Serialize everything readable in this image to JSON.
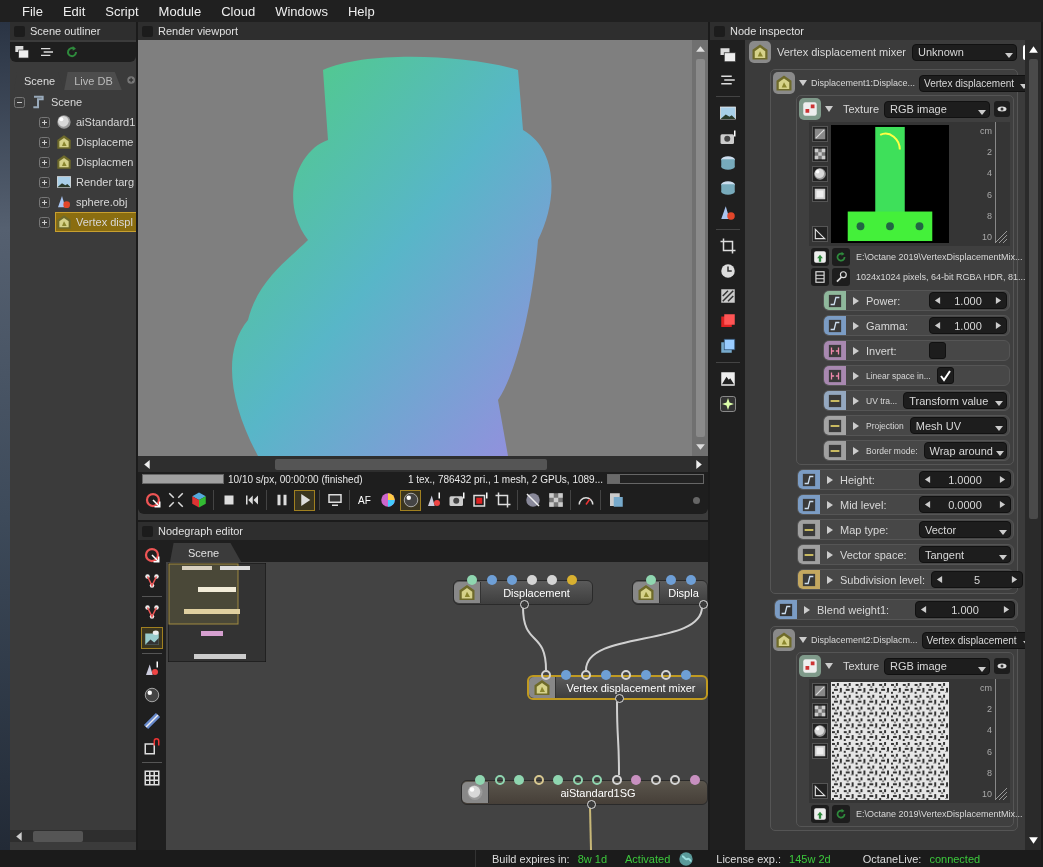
{
  "menu": [
    "File",
    "Edit",
    "Script",
    "Module",
    "Cloud",
    "Windows",
    "Help"
  ],
  "outliner": {
    "title": "Scene outliner",
    "tabs": [
      {
        "label": "Scene",
        "selected": true
      },
      {
        "label": "Live DB",
        "selected": false
      }
    ],
    "root": {
      "label": "Scene",
      "expanded": true,
      "children": [
        {
          "label": "aiStandard1",
          "kind": "material",
          "expanded": false,
          "selected": false
        },
        {
          "label": "Displaceme",
          "kind": "displacement",
          "expanded": false,
          "selected": false
        },
        {
          "label": "Displacmen",
          "kind": "displacement",
          "expanded": false,
          "selected": false
        },
        {
          "label": "Render targ",
          "kind": "render-target",
          "expanded": false,
          "selected": false
        },
        {
          "label": "sphere.obj",
          "kind": "mesh",
          "expanded": false,
          "selected": false
        },
        {
          "label": "Vertex displ",
          "kind": "displacement",
          "expanded": false,
          "selected": true
        }
      ]
    }
  },
  "viewport": {
    "title": "Render viewport",
    "progress": {
      "level": 1
    },
    "status": "10/10 s/px, 00:00:00 (finished)",
    "stats": "1 tex., 786432 pri., 1 mesh, 2 GPUs, 1089...",
    "memory": {
      "level": 0.13
    },
    "toolbar": [
      {
        "selected": false
      },
      {
        "selected": false
      },
      {
        "selected": false
      },
      {
        "selected": false
      },
      {
        "selected": false
      },
      {
        "selected": false
      },
      {
        "selected": true
      },
      {
        "selected": false
      },
      {
        "label": "AF",
        "selected": false
      },
      {
        "selected": false
      },
      {
        "selected": true
      },
      {
        "selected": false
      },
      {
        "selected": false
      },
      {
        "selected": false
      },
      {
        "selected": false
      },
      {
        "selected": false
      },
      {
        "selected": false
      },
      {
        "selected": false
      },
      {
        "selected": false
      }
    ]
  },
  "nodegraph": {
    "title": "Nodegraph editor",
    "tools": [
      {
        "selected": false
      },
      {
        "selected": false
      },
      {
        "selected": false
      },
      {
        "selected": true
      },
      {
        "selected": false
      },
      {
        "selected": false
      },
      {
        "selected": false
      },
      {
        "selected": false
      },
      {
        "selected": false
      }
    ],
    "tabs": [
      {
        "label": "Scene",
        "selected": true
      }
    ],
    "nodes": [
      {
        "label": "Displacement",
        "kind": "displacement",
        "selected": false,
        "pins": [
          {
            "kind": "filled",
            "color": "#8fd6b0"
          },
          {
            "kind": "filled",
            "color": "#6e9fd6"
          },
          {
            "kind": "filled",
            "color": "#6e9fd6"
          },
          {
            "kind": "filled",
            "color": "#d4d4d4"
          },
          {
            "kind": "filled",
            "color": "#d4d4d4"
          },
          {
            "kind": "filled",
            "color": "#d8b030"
          }
        ]
      },
      {
        "label": "Displa",
        "kind": "displacement",
        "selected": false,
        "pins": [
          {
            "kind": "filled",
            "color": "#8fd6b0"
          },
          {
            "kind": "filled",
            "color": "#6e9fd6"
          },
          {
            "kind": "filled",
            "color": "#6e9fd6"
          }
        ]
      },
      {
        "label": "Vertex displacement mixer",
        "kind": "displacement",
        "selected": true,
        "pins": [
          {
            "kind": "ring",
            "color": "#d4d4d4"
          },
          {
            "kind": "filled",
            "color": "#6e9fd6"
          },
          {
            "kind": "ring",
            "color": "#d4d4d4"
          },
          {
            "kind": "filled",
            "color": "#6e9fd6"
          },
          {
            "kind": "ring",
            "color": "#d4d4d4"
          },
          {
            "kind": "filled",
            "color": "#6e9fd6"
          },
          {
            "kind": "ring",
            "color": "#d4d4d4"
          },
          {
            "kind": "filled",
            "color": "#6e9fd6"
          }
        ]
      },
      {
        "label": "aiStandard1SG",
        "kind": "material",
        "selected": false,
        "pins": [
          {
            "kind": "filled",
            "color": "#8fd6b0"
          },
          {
            "kind": "ring",
            "color": "#8fd6b0"
          },
          {
            "kind": "filled",
            "color": "#8fd6b0"
          },
          {
            "kind": "ring",
            "color": "#d8c890"
          },
          {
            "kind": "filled",
            "color": "#8fd6b0"
          },
          {
            "kind": "ring",
            "color": "#8fd6b0"
          },
          {
            "kind": "ring",
            "color": "#8fd6b0"
          },
          {
            "kind": "ring",
            "color": "#d4d4d4"
          },
          {
            "kind": "filled",
            "color": "#c890c0"
          },
          {
            "kind": "ring",
            "color": "#d4d4d4"
          },
          {
            "kind": "ring",
            "color": "#d4d4d4"
          },
          {
            "kind": "filled",
            "color": "#c890c0"
          }
        ]
      }
    ],
    "wires": [
      {
        "color": "#d0d0d0"
      },
      {
        "color": "#d0d0d0"
      },
      {
        "color": "#d0d0d0"
      },
      {
        "color": "#c8b878"
      }
    ]
  },
  "inspector": {
    "title": "Node inspector",
    "node": {
      "label": "Vertex displacement mixer",
      "value": "Unknown"
    },
    "groups": [
      {
        "kind": "group",
        "label": "Displacement1:Displace...",
        "value": "Vertex displacement",
        "expanded": true,
        "texture": {
          "label": "Texture",
          "value": "RGB image",
          "expanded": true,
          "preview": {
            "kind": "normal-map"
          },
          "ruler": [
            "cm",
            "2",
            "4",
            "6",
            "8",
            "10"
          ],
          "file": "E:\\Octane 2019\\VertexDisplacementMix...",
          "info": "1024x1024 pixels, 64-bit RGBA HDR, 81...",
          "params": [
            {
              "label": "Power:",
              "kind": "number",
              "value": "1.000",
              "color": "#8fb89c"
            },
            {
              "label": "Gamma:",
              "kind": "number",
              "value": "1.000",
              "color": "#7b9cc4"
            },
            {
              "label": "Invert:",
              "kind": "checkbox",
              "checked": false,
              "color": "#a888b0"
            },
            {
              "label": "Linear space in...",
              "kind": "checkbox",
              "checked": true,
              "color": "#a888b0"
            },
            {
              "label": "UV tra...",
              "kind": "dropdown",
              "value": "Transform value",
              "color": "#94a8c0"
            },
            {
              "label": "Projection",
              "kind": "dropdown",
              "value": "Mesh UV",
              "color": "#a4a4a4"
            },
            {
              "label": "Border mode:",
              "kind": "dropdown",
              "value": "Wrap around",
              "color": "#a0a0a0"
            }
          ]
        },
        "params": [
          {
            "label": "Height:",
            "kind": "number",
            "value": "1.0000",
            "color": "#7b9cc4"
          },
          {
            "label": "Mid level:",
            "kind": "number",
            "value": "0.0000",
            "color": "#7b9cc4"
          },
          {
            "label": "Map type:",
            "kind": "dropdown",
            "value": "Vector",
            "color": "#a0a0a0"
          },
          {
            "label": "Vector space:",
            "kind": "dropdown",
            "value": "Tangent",
            "color": "#a0a0a0"
          },
          {
            "label": "Subdivision level:",
            "kind": "number",
            "value": "5",
            "color": "#c4a860"
          }
        ]
      },
      {
        "kind": "param",
        "label": "Blend weight1:",
        "value": "1.000",
        "color": "#7b9cc4"
      },
      {
        "kind": "group",
        "label": "Displacement2:Displacm...",
        "value": "Vertex displacement",
        "expanded": true,
        "texture": {
          "label": "Texture",
          "value": "RGB image",
          "expanded": true,
          "preview": {
            "kind": "noise"
          },
          "ruler": [
            "cm",
            "2",
            "4",
            "6",
            "8",
            "10"
          ],
          "file": "E:\\Octane 2019\\VertexDisplacementMix..."
        }
      }
    ]
  },
  "status_bar": {
    "build": {
      "label": "Build expires in:",
      "value": "8w 1d"
    },
    "activation": "Activated",
    "license": {
      "label": "License exp.:",
      "value": "145w 2d"
    },
    "live": {
      "label": "OctaneLive:",
      "value": "connected"
    }
  }
}
